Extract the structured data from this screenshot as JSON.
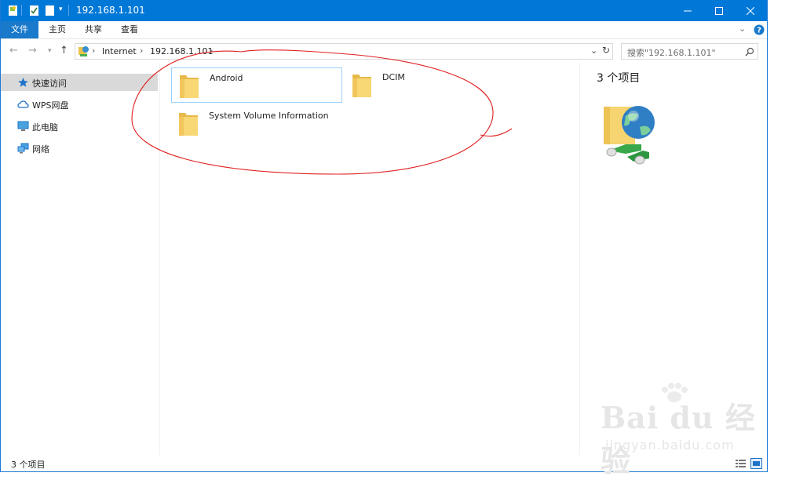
{
  "window": {
    "title": "192.168.1.101"
  },
  "ribbon": {
    "tabs": [
      "文件",
      "主页",
      "共享",
      "查看"
    ]
  },
  "address": {
    "crumbs": [
      "Internet",
      "192.168.1.101"
    ]
  },
  "search": {
    "placeholder": "搜索\"192.168.1.101\""
  },
  "nav": {
    "items": [
      "快速访问",
      "WPS网盘",
      "此电脑",
      "网络"
    ],
    "selected": 0
  },
  "items": [
    {
      "name": "Android",
      "selected": true
    },
    {
      "name": "DCIM",
      "selected": false
    },
    {
      "name": "System Volume Information",
      "selected": false
    }
  ],
  "details": {
    "count": "3 个项目"
  },
  "status": {
    "count": "3 个项目"
  },
  "watermark": {
    "logo": "Bai du 经验",
    "url": "jingyan.baidu.com"
  },
  "colors": {
    "accent": "#0078d7",
    "annotation": "#e02020",
    "folder": "#f8d775"
  }
}
